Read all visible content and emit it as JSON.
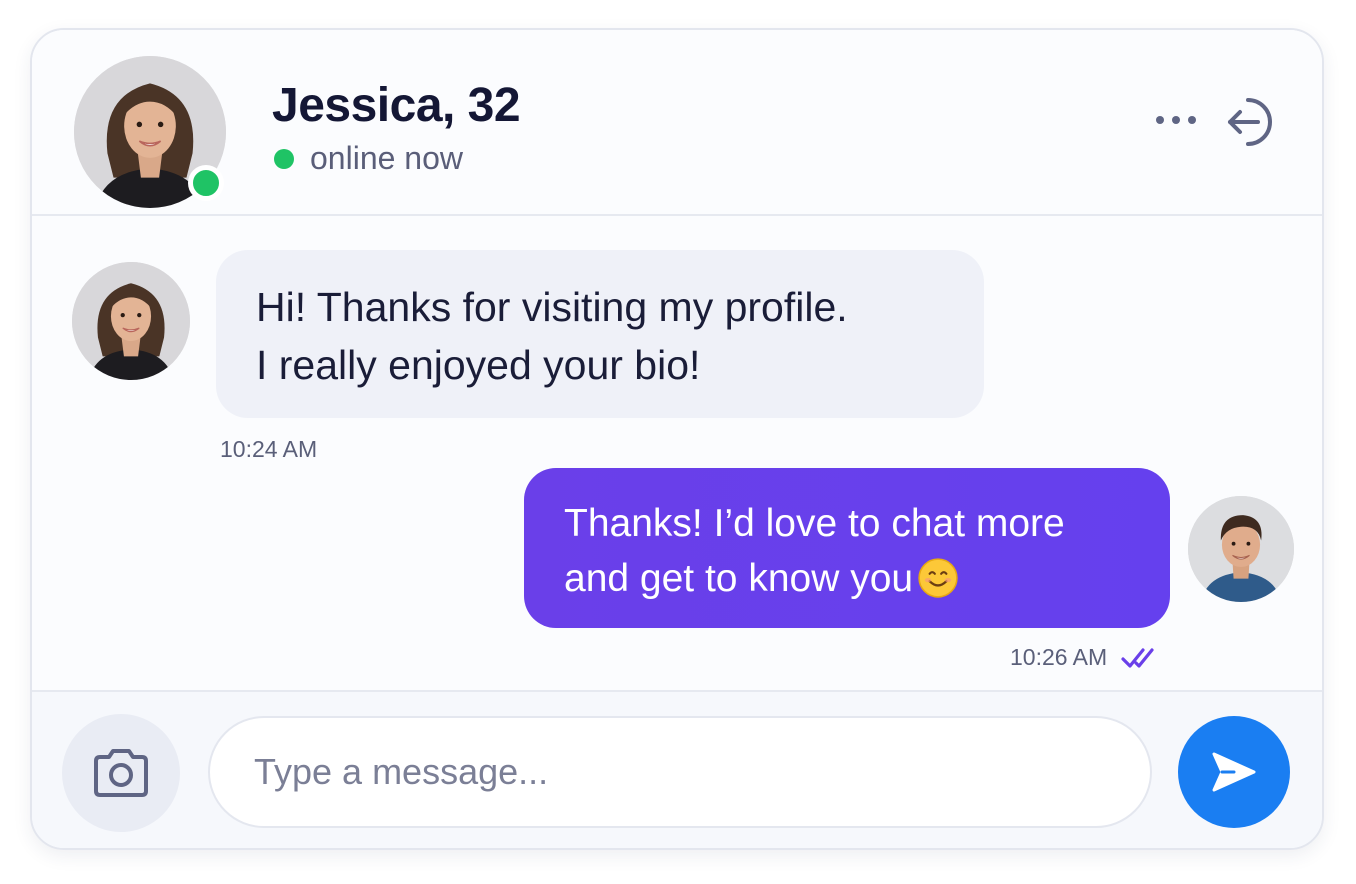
{
  "header": {
    "name": "Jessica, 32",
    "status": "online now",
    "more_icon": "ellipsis-horizontal-icon",
    "exit_icon": "exit-arrow-icon"
  },
  "messages": [
    {
      "direction": "incoming",
      "lines": [
        "Hi! Thanks for visiting my profile.",
        "I really enjoyed your bio!"
      ],
      "time": "10:24 AM"
    },
    {
      "direction": "outgoing",
      "lines": [
        "Thanks! I’d love to chat more",
        "and get to know you"
      ],
      "emoji": "smiling-face-emoji",
      "time": "10:26 AM",
      "read_icon": "double-check-icon"
    }
  ],
  "composer": {
    "placeholder": "Type a message...",
    "camera_icon": "camera-icon",
    "send_icon": "send-icon"
  },
  "colors": {
    "online": "#1fc365",
    "outgoing_bubble": "#6540ee",
    "incoming_bubble": "#eff1f8",
    "send_button": "#1a7ef2",
    "read_check": "#6a3fe9"
  }
}
